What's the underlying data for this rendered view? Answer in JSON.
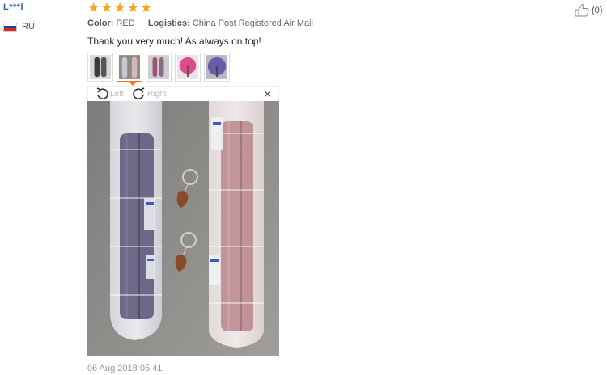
{
  "reviewer": {
    "name": "L***l",
    "country": "RU"
  },
  "rating": {
    "stars": 5
  },
  "meta": {
    "color_label": "Color:",
    "color_value": "RED",
    "logistics_label": "Logistics:",
    "logistics_value": "China Post Registered Air Mail"
  },
  "helpful": {
    "count": "(0)"
  },
  "review_text": "Thank you very much! As always on top!",
  "thumbnails": [
    {
      "icon": "umbrella-photo-1",
      "tint": "#3a3a3a"
    },
    {
      "icon": "umbrella-photo-2",
      "tint": "#9a8f92",
      "active": true
    },
    {
      "icon": "umbrella-photo-3",
      "tint": "#a0507a"
    },
    {
      "icon": "umbrella-photo-4",
      "tint": "#e04a8a"
    },
    {
      "icon": "umbrella-photo-5",
      "tint": "#6a5aa8"
    }
  ],
  "viewer": {
    "rotate_left_label": "Left",
    "rotate_right_label": "Right"
  },
  "date": "06 Aug 2018 05:41",
  "colors": {
    "accent": "#f57224",
    "star": "#f5a623",
    "username": "#2a5db0"
  }
}
